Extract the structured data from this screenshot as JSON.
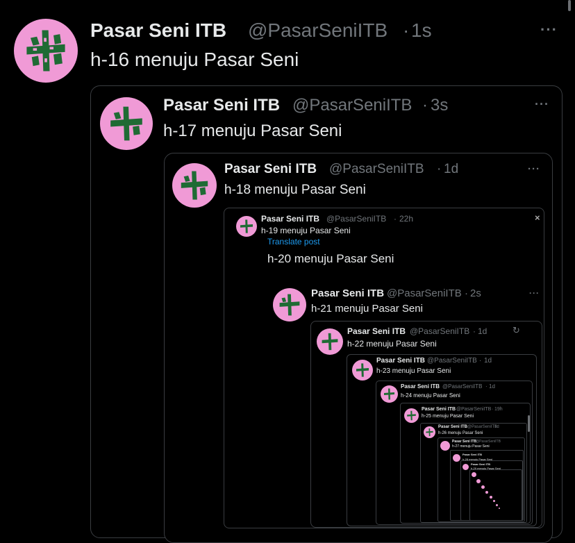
{
  "account": {
    "name": "Pasar Seni ITB",
    "handle": "@PasarSeniITB"
  },
  "more_glyph": "···",
  "brand_color": "#f09ad6",
  "posts": [
    {
      "text": "h-16 menuju Pasar Seni",
      "time": "1s"
    },
    {
      "text": "h-17 menuju Pasar Seni",
      "time": "3s"
    },
    {
      "text": "h-18 menuju Pasar Seni",
      "time": "1d"
    },
    {
      "text": "h-19 menuju Pasar Seni",
      "time": "22h"
    },
    {
      "text": "h-20 menuju Pasar Seni"
    },
    {
      "text": "h-21 menuju Pasar Seni",
      "time": "2s"
    },
    {
      "text": "h-22 menuju Pasar Seni",
      "time": "1d"
    },
    {
      "text": "h-23 menuju Pasar Seni",
      "time": "1d"
    },
    {
      "text": "h-24 menuju Pasar Seni",
      "time": "1d"
    },
    {
      "text": "h-25 menuju Pasar Seni",
      "time": "19h"
    },
    {
      "text": "h-26 menuju Pasar Seni",
      "time": "1d"
    },
    {
      "text": "h-27 menuju Pasar Seni",
      "time": ""
    },
    {
      "text": "h-28 menuju Pasar Seni",
      "time": ""
    },
    {
      "text": "h-29 menuju Pasar Seni",
      "time": ""
    }
  ],
  "translate_label": "Translate post",
  "icons": [
    "more-icon",
    "close-icon",
    "refresh-icon",
    "logo-avatar-icon"
  ]
}
